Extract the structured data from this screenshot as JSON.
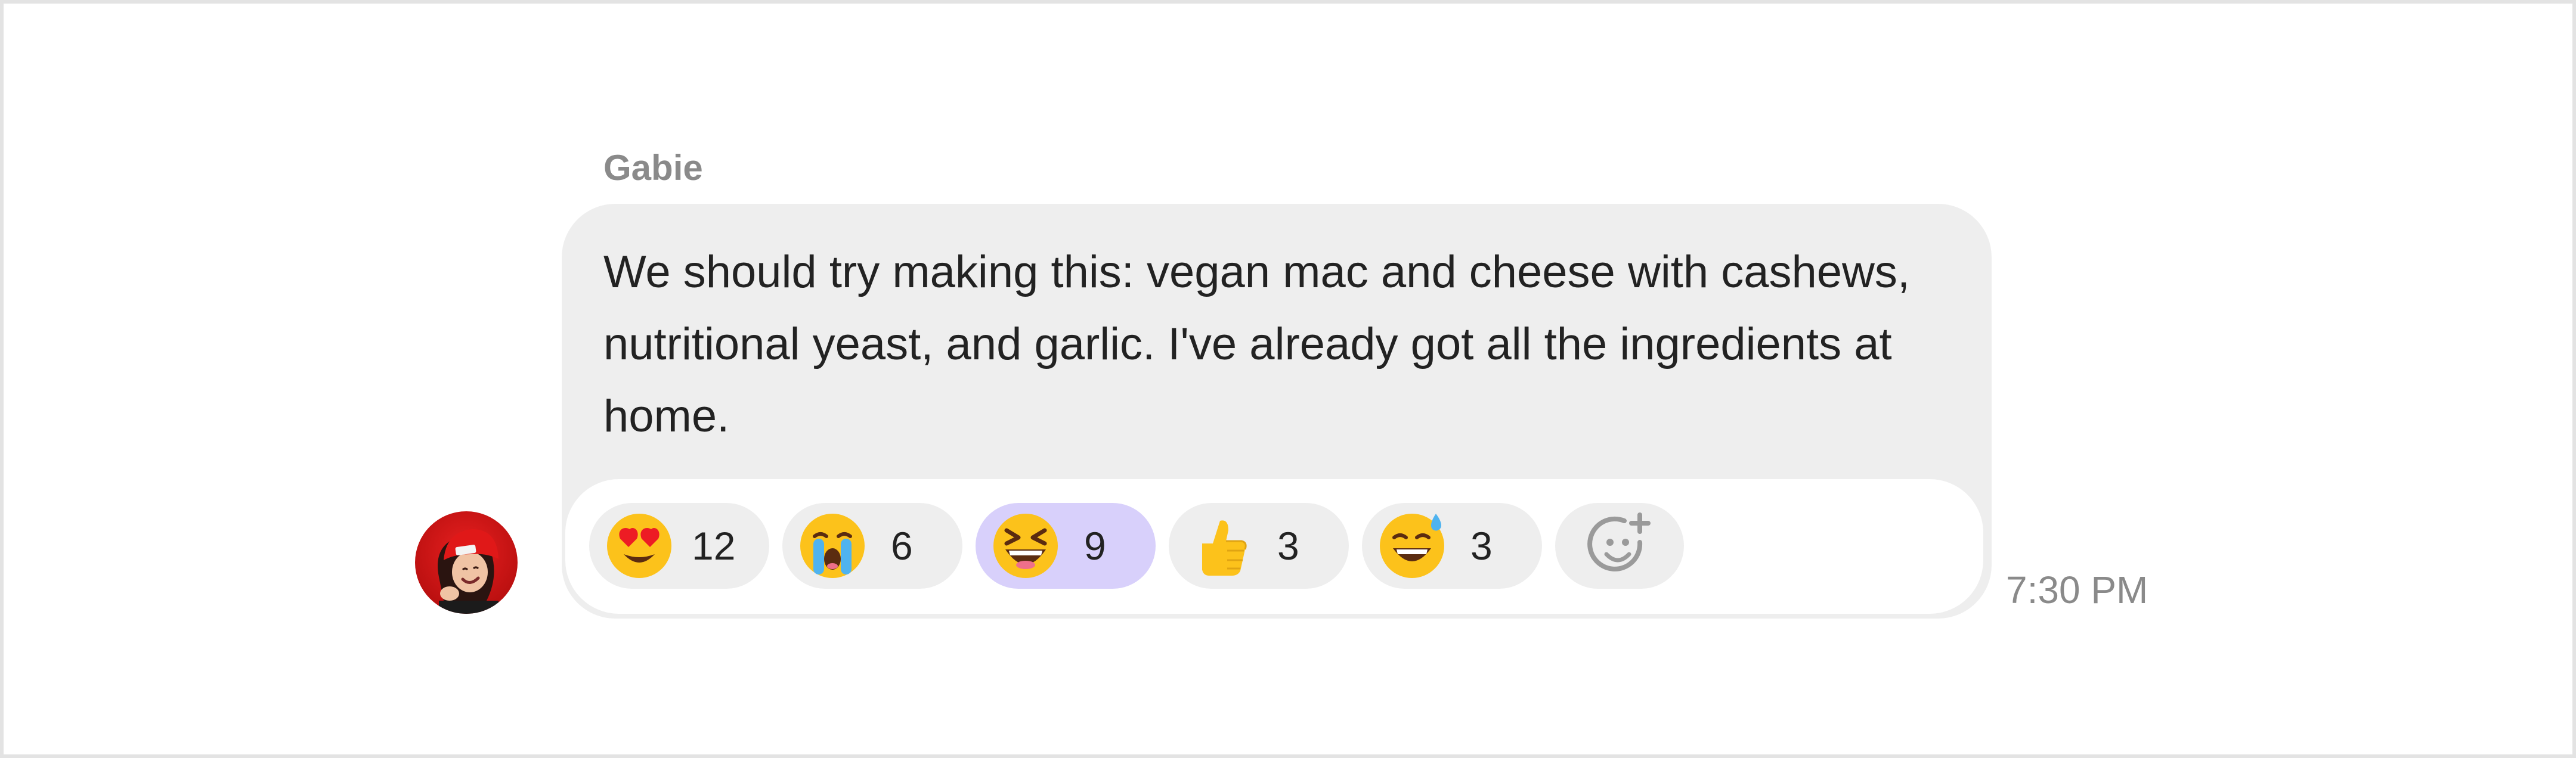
{
  "message": {
    "sender": "Gabie",
    "text": "We should try making this: vegan mac and cheese with cashews, nutritional yeast, and garlic. I've already got all the ingredients at home.",
    "time": "7:30 PM",
    "avatar_icon": "profile-photo-red-beanie"
  },
  "reactions": [
    {
      "icon": "heart-eyes-emoji",
      "count": "12",
      "selected": false
    },
    {
      "icon": "loudly-crying-emoji",
      "count": "6",
      "selected": false
    },
    {
      "icon": "squinting-laughing-emoji",
      "count": "9",
      "selected": true
    },
    {
      "icon": "thumbs-up-emoji",
      "count": "3",
      "selected": false
    },
    {
      "icon": "grinning-sweat-emoji",
      "count": "3",
      "selected": false
    }
  ],
  "add_reaction": {
    "icon": "add-emoji-icon"
  },
  "colors": {
    "bubble": "#eeeeee",
    "selected_reaction": "#d8d0fb",
    "muted_text": "#8a8a8a",
    "text": "#222222",
    "emoji_yellow": "#fcc21b",
    "avatar_red": "#d01212"
  }
}
